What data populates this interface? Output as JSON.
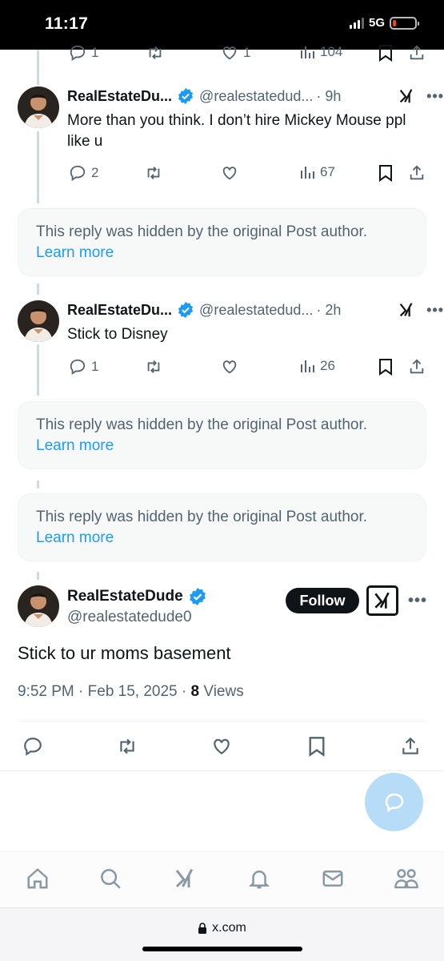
{
  "status_bar": {
    "time": "11:17",
    "network": "5G",
    "battery_level": 0.12
  },
  "top_partial_actions": {
    "replies": "1",
    "likes": "1",
    "views": "104"
  },
  "replies": [
    {
      "name": "RealEstateDu...",
      "handle": "@realestatedud...",
      "time": "· 9h",
      "text": "More than you think. I don’t hire Mickey Mouse ppl like u",
      "reply_count": "2",
      "retweet_count": "",
      "like_count": "",
      "view_count": "67"
    },
    {
      "name": "RealEstateDu...",
      "handle": "@realestatedud...",
      "time": "· 2h",
      "text": "Stick to Disney",
      "reply_count": "1",
      "retweet_count": "",
      "like_count": "",
      "view_count": "26"
    }
  ],
  "hidden_notice": {
    "text": "This reply was hidden by the original Post author.",
    "link": "Learn more"
  },
  "main_post": {
    "name": "RealEstateDude",
    "handle": "@realestatedude0",
    "follow_label": "Follow",
    "text": "Stick to ur moms basement",
    "timestamp": "9:52 PM · Feb 15, 2025 · ",
    "views_count": "8",
    "views_label": " Views"
  },
  "tabs": [
    "home-icon",
    "search-icon",
    "grok-icon",
    "notifications-icon",
    "messages-icon",
    "communities-icon"
  ],
  "browser": {
    "url": "x.com"
  },
  "colors": {
    "accent": "#1d9bf0",
    "verified": "#1d9bf0",
    "text": "#0f1419",
    "muted": "#536471",
    "fab": "#b7dcf8"
  }
}
